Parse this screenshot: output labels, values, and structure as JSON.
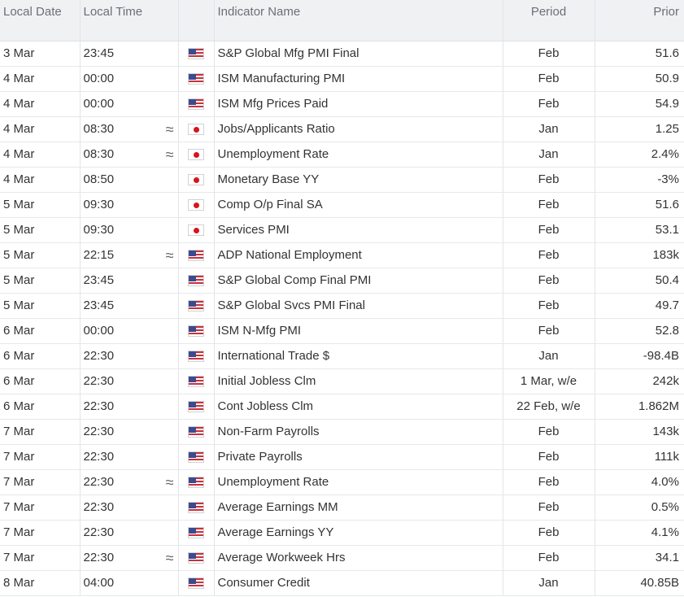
{
  "headers": {
    "date": "Local Date",
    "time": "Local Time",
    "indicator": "Indicator Name",
    "period": "Period",
    "prior": "Prior"
  },
  "rows": [
    {
      "date": "3 Mar",
      "time": "23:45",
      "wave": "",
      "flag": "us-flag-icon",
      "indicator": "S&P Global Mfg PMI Final",
      "period": "Feb",
      "prior": "51.6"
    },
    {
      "date": "4 Mar",
      "time": "00:00",
      "wave": "",
      "flag": "us-flag-icon",
      "indicator": "ISM Manufacturing PMI",
      "period": "Feb",
      "prior": "50.9"
    },
    {
      "date": "4 Mar",
      "time": "00:00",
      "wave": "",
      "flag": "us-flag-icon",
      "indicator": "ISM Mfg Prices Paid",
      "period": "Feb",
      "prior": "54.9"
    },
    {
      "date": "4 Mar",
      "time": "08:30",
      "wave": "≈",
      "flag": "jp-flag-icon",
      "indicator": "Jobs/Applicants Ratio",
      "period": "Jan",
      "prior": "1.25"
    },
    {
      "date": "4 Mar",
      "time": "08:30",
      "wave": "≈",
      "flag": "jp-flag-icon",
      "indicator": "Unemployment Rate",
      "period": "Jan",
      "prior": "2.4%"
    },
    {
      "date": "4 Mar",
      "time": "08:50",
      "wave": "",
      "flag": "jp-flag-icon",
      "indicator": "Monetary Base YY",
      "period": "Feb",
      "prior": "-3%"
    },
    {
      "date": "5 Mar",
      "time": "09:30",
      "wave": "",
      "flag": "jp-flag-icon",
      "indicator": "Comp O/p Final SA",
      "period": "Feb",
      "prior": "51.6"
    },
    {
      "date": "5 Mar",
      "time": "09:30",
      "wave": "",
      "flag": "jp-flag-icon",
      "indicator": "Services PMI",
      "period": "Feb",
      "prior": "53.1"
    },
    {
      "date": "5 Mar",
      "time": "22:15",
      "wave": "≈",
      "flag": "us-flag-icon",
      "indicator": "ADP National Employment",
      "period": "Feb",
      "prior": "183k"
    },
    {
      "date": "5 Mar",
      "time": "23:45",
      "wave": "",
      "flag": "us-flag-icon",
      "indicator": "S&P Global Comp Final PMI",
      "period": "Feb",
      "prior": "50.4"
    },
    {
      "date": "5 Mar",
      "time": "23:45",
      "wave": "",
      "flag": "us-flag-icon",
      "indicator": "S&P Global Svcs PMI Final",
      "period": "Feb",
      "prior": "49.7"
    },
    {
      "date": "6 Mar",
      "time": "00:00",
      "wave": "",
      "flag": "us-flag-icon",
      "indicator": "ISM N-Mfg PMI",
      "period": "Feb",
      "prior": "52.8"
    },
    {
      "date": "6 Mar",
      "time": "22:30",
      "wave": "",
      "flag": "us-flag-icon",
      "indicator": "International Trade $",
      "period": "Jan",
      "prior": "-98.4B"
    },
    {
      "date": "6 Mar",
      "time": "22:30",
      "wave": "",
      "flag": "us-flag-icon",
      "indicator": "Initial Jobless Clm",
      "period": "1 Mar, w/e",
      "prior": "242k"
    },
    {
      "date": "6 Mar",
      "time": "22:30",
      "wave": "",
      "flag": "us-flag-icon",
      "indicator": "Cont Jobless Clm",
      "period": "22 Feb, w/e",
      "prior": "1.862M"
    },
    {
      "date": "7 Mar",
      "time": "22:30",
      "wave": "",
      "flag": "us-flag-icon",
      "indicator": "Non-Farm Payrolls",
      "period": "Feb",
      "prior": "143k"
    },
    {
      "date": "7 Mar",
      "time": "22:30",
      "wave": "",
      "flag": "us-flag-icon",
      "indicator": "Private Payrolls",
      "period": "Feb",
      "prior": "111k"
    },
    {
      "date": "7 Mar",
      "time": "22:30",
      "wave": "≈",
      "flag": "us-flag-icon",
      "indicator": "Unemployment Rate",
      "period": "Feb",
      "prior": "4.0%"
    },
    {
      "date": "7 Mar",
      "time": "22:30",
      "wave": "",
      "flag": "us-flag-icon",
      "indicator": "Average Earnings MM",
      "period": "Feb",
      "prior": "0.5%"
    },
    {
      "date": "7 Mar",
      "time": "22:30",
      "wave": "",
      "flag": "us-flag-icon",
      "indicator": "Average Earnings YY",
      "period": "Feb",
      "prior": "4.1%"
    },
    {
      "date": "7 Mar",
      "time": "22:30",
      "wave": "≈",
      "flag": "us-flag-icon",
      "indicator": "Average Workweek Hrs",
      "period": "Feb",
      "prior": "34.1"
    },
    {
      "date": "8 Mar",
      "time": "04:00",
      "wave": "",
      "flag": "us-flag-icon",
      "indicator": "Consumer Credit",
      "period": "Jan",
      "prior": "40.85B"
    }
  ]
}
